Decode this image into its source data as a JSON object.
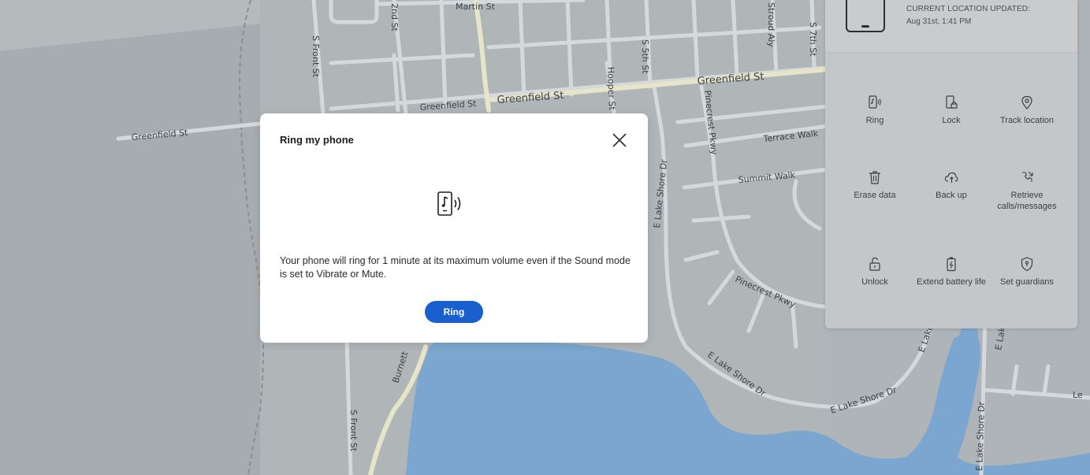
{
  "map": {
    "streets": {
      "martin_st": "Martin St",
      "second_st": "2nd St",
      "s_front_st_top": "S Front St",
      "s_front_st_bottom": "S Front St",
      "greenfield_st_west": "Greenfield St",
      "greenfield_st_mid_small": "Greenfield St",
      "greenfield_st_mid": "Greenfield St",
      "greenfield_st_east": "Greenfield St",
      "hooper_st": "Hooper St",
      "s_5th_st": "S 5th St",
      "stroud_aly": "Stroud Aly",
      "s_7th_st": "S 7th St",
      "pinecrest_pkwy_vertical": "Pinecrest Pkwy",
      "pinecrest_pkwy": "Pinecrest Pkwy",
      "terrace_walk": "Terrace Walk",
      "summit_walk": "Summit Walk",
      "e_lake_shore_dr_vertical": "E Lake Shore Dr",
      "e_lake_shore_dr_curve": "E Lake Shore Dr",
      "e_lake_shore_dr_south": "E Lake Shore Dr",
      "e_lake_shore_dr_east": "E Lake Shore Dr",
      "e_lake_partial": "E Lake",
      "e_lake_shore_dr_far_east": "E Lake Shore Dr",
      "burnett": "Burnett",
      "le_partial": "Le"
    },
    "colors": {
      "land": "#aeb4b8",
      "land_dark": "#a3a9ad",
      "water": "#7aa6cf",
      "road": "#dfe1e2",
      "major_road": "#e4e2c8"
    }
  },
  "panel": {
    "location_label": "CURRENT LOCATION UPDATED:",
    "location_time": "Aug 31st, 1:41 PM",
    "actions": [
      {
        "label": "Ring",
        "icon": "ring-phone-icon"
      },
      {
        "label": "Lock",
        "icon": "lock-phone-icon"
      },
      {
        "label": "Track location",
        "icon": "location-pin-icon"
      },
      {
        "label": "Erase data",
        "icon": "trash-icon"
      },
      {
        "label": "Back up",
        "icon": "cloud-backup-icon"
      },
      {
        "label": "Retrieve calls/messages",
        "icon": "retrieve-calls-icon"
      },
      {
        "label": "Unlock",
        "icon": "unlock-icon"
      },
      {
        "label": "Extend battery life",
        "icon": "battery-icon"
      },
      {
        "label": "Set guardians",
        "icon": "shield-icon"
      }
    ]
  },
  "dialog": {
    "title": "Ring my phone",
    "message": "Your phone will ring for 1 minute at its maximum volume even if the Sound mode is set to Vibrate or Mute.",
    "ring_button": "Ring",
    "icon": "ring-phone-icon",
    "close_icon": "close-icon",
    "button_color": "#1a5fd0"
  }
}
